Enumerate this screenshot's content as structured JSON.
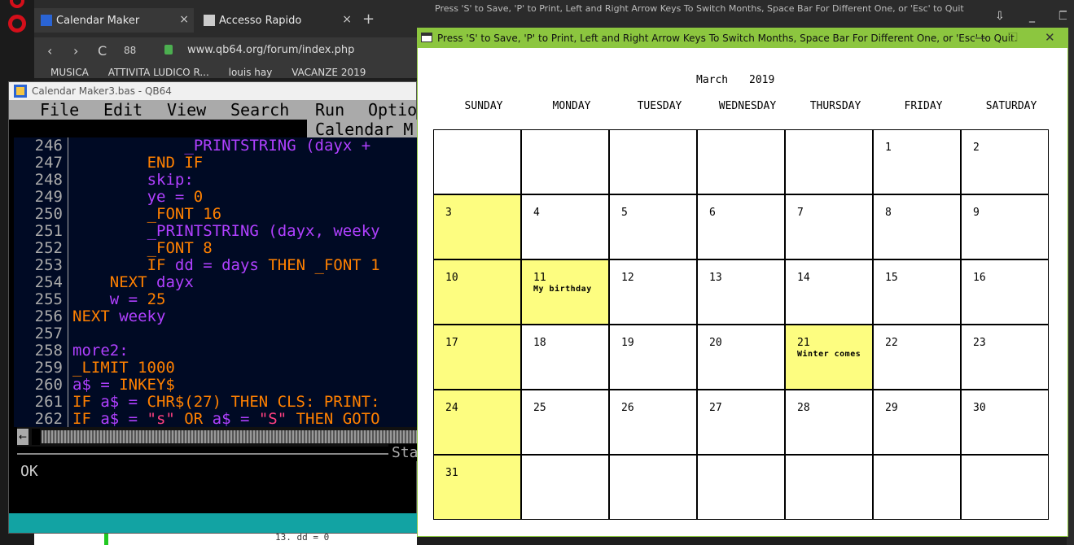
{
  "browser": {
    "tabs": [
      {
        "label": "Calendar Maker",
        "close": "×"
      },
      {
        "label": "Accesso Rapido",
        "close": "×"
      }
    ],
    "new_tab": "+",
    "back": "‹",
    "forward": "›",
    "reload": "C",
    "grid": "88",
    "url": "www.qb64.org/forum/index.php",
    "bookmarks": [
      "MUSICA",
      "ATTIVITA LUDICO R...",
      "louis hay",
      "VACANZE 2019"
    ],
    "code_snippet": "13.  dd = 0"
  },
  "qb64": {
    "title": "Calendar Maker3.bas - QB64",
    "menu": [
      "File",
      "Edit",
      "View",
      "Search",
      "Run",
      "Optio"
    ],
    "subbar": "Calendar M",
    "status_label": "Sta",
    "output": "OK",
    "scroll_left": "←",
    "lines": [
      {
        "n": "246",
        "indent": "            ",
        "tokens": [
          {
            "t": "_PRINTSTRING (dayx + ",
            "c": "vr"
          }
        ]
      },
      {
        "n": "247",
        "indent": "        ",
        "tokens": [
          {
            "t": "END IF",
            "c": "kw"
          }
        ]
      },
      {
        "n": "248",
        "indent": "        ",
        "tokens": [
          {
            "t": "skip:",
            "c": "vr"
          }
        ]
      },
      {
        "n": "249",
        "indent": "        ",
        "tokens": [
          {
            "t": "ye = ",
            "c": "vr"
          },
          {
            "t": "0",
            "c": "nm"
          }
        ]
      },
      {
        "n": "250",
        "indent": "        ",
        "tokens": [
          {
            "t": "_FONT ",
            "c": "kw"
          },
          {
            "t": "16",
            "c": "nm"
          }
        ]
      },
      {
        "n": "251",
        "indent": "        ",
        "tokens": [
          {
            "t": "_PRINTSTRING (dayx, weeky",
            "c": "vr"
          }
        ]
      },
      {
        "n": "252",
        "indent": "        ",
        "tokens": [
          {
            "t": "_FONT ",
            "c": "kw"
          },
          {
            "t": "8",
            "c": "nm"
          }
        ]
      },
      {
        "n": "253",
        "indent": "        ",
        "tokens": [
          {
            "t": "IF ",
            "c": "kw"
          },
          {
            "t": "dd = days ",
            "c": "vr"
          },
          {
            "t": "THEN _FONT 1",
            "c": "kw"
          }
        ]
      },
      {
        "n": "254",
        "indent": "    ",
        "tokens": [
          {
            "t": "NEXT ",
            "c": "kw"
          },
          {
            "t": "dayx",
            "c": "vr"
          }
        ]
      },
      {
        "n": "255",
        "indent": "    ",
        "tokens": [
          {
            "t": "w = ",
            "c": "vr"
          },
          {
            "t": "25",
            "c": "nm"
          }
        ]
      },
      {
        "n": "256",
        "indent": "",
        "tokens": [
          {
            "t": "NEXT ",
            "c": "kw"
          },
          {
            "t": "weeky",
            "c": "vr"
          }
        ]
      },
      {
        "n": "257",
        "indent": "",
        "tokens": []
      },
      {
        "n": "258",
        "indent": "",
        "tokens": [
          {
            "t": "more2:",
            "c": "vr"
          }
        ]
      },
      {
        "n": "259",
        "indent": "",
        "tokens": [
          {
            "t": "_LIMIT ",
            "c": "kw"
          },
          {
            "t": "1000",
            "c": "nm"
          }
        ]
      },
      {
        "n": "260",
        "indent": "",
        "tokens": [
          {
            "t": "a$ = ",
            "c": "vr"
          },
          {
            "t": "INKEY$",
            "c": "kw"
          }
        ]
      },
      {
        "n": "261",
        "indent": "",
        "tokens": [
          {
            "t": "IF ",
            "c": "kw"
          },
          {
            "t": "a$ = ",
            "c": "vr"
          },
          {
            "t": "CHR$(27) THEN CLS: PRINT:",
            "c": "kw"
          }
        ]
      },
      {
        "n": "262",
        "indent": "",
        "tokens": [
          {
            "t": "IF ",
            "c": "kw"
          },
          {
            "t": "a$ = ",
            "c": "vr"
          },
          {
            "t": "\"s\" ",
            "c": "st"
          },
          {
            "t": "OR ",
            "c": "kw"
          },
          {
            "t": "a$ = ",
            "c": "vr"
          },
          {
            "t": "\"S\" ",
            "c": "st"
          },
          {
            "t": "THEN GOTO",
            "c": "kw"
          }
        ]
      }
    ]
  },
  "background_window": {
    "title": "Press 'S' to Save, 'P' to Print, Left and Right Arrow Keys To Switch Months, Space Bar For Different One, or 'Esc' to Quit."
  },
  "calendar_window": {
    "title": "Press 'S' to Save, 'P' to Print, Left and Right Arrow Keys To Switch Months, Space Bar For Different One, or 'Esc' to Quit.",
    "minimize": "—",
    "maximize": "☐",
    "close": "✕",
    "month": "March",
    "year": "2019",
    "day_headers": [
      "SUNDAY",
      "MONDAY",
      "TUESDAY",
      "WEDNESDAY",
      "THURSDAY",
      "FRIDAY",
      "SATURDAY"
    ],
    "highlight_color": "#fdfd80",
    "weeks": [
      [
        {
          "d": ""
        },
        {
          "d": ""
        },
        {
          "d": ""
        },
        {
          "d": ""
        },
        {
          "d": ""
        },
        {
          "d": "1"
        },
        {
          "d": "2"
        }
      ],
      [
        {
          "d": "3",
          "hl": true
        },
        {
          "d": "4"
        },
        {
          "d": "5"
        },
        {
          "d": "6"
        },
        {
          "d": "7"
        },
        {
          "d": "8"
        },
        {
          "d": "9"
        }
      ],
      [
        {
          "d": "10",
          "hl": true
        },
        {
          "d": "11",
          "hl": true,
          "note": "My birthday"
        },
        {
          "d": "12"
        },
        {
          "d": "13"
        },
        {
          "d": "14"
        },
        {
          "d": "15"
        },
        {
          "d": "16"
        }
      ],
      [
        {
          "d": "17",
          "hl": true
        },
        {
          "d": "18"
        },
        {
          "d": "19"
        },
        {
          "d": "20"
        },
        {
          "d": "21",
          "hl": true,
          "note": "Winter comes"
        },
        {
          "d": "22"
        },
        {
          "d": "23"
        }
      ],
      [
        {
          "d": "24",
          "hl": true
        },
        {
          "d": "25"
        },
        {
          "d": "26"
        },
        {
          "d": "27"
        },
        {
          "d": "28"
        },
        {
          "d": "29"
        },
        {
          "d": "30"
        }
      ],
      [
        {
          "d": "31",
          "hl": true
        },
        {
          "d": ""
        },
        {
          "d": ""
        },
        {
          "d": ""
        },
        {
          "d": ""
        },
        {
          "d": ""
        },
        {
          "d": ""
        }
      ]
    ]
  }
}
